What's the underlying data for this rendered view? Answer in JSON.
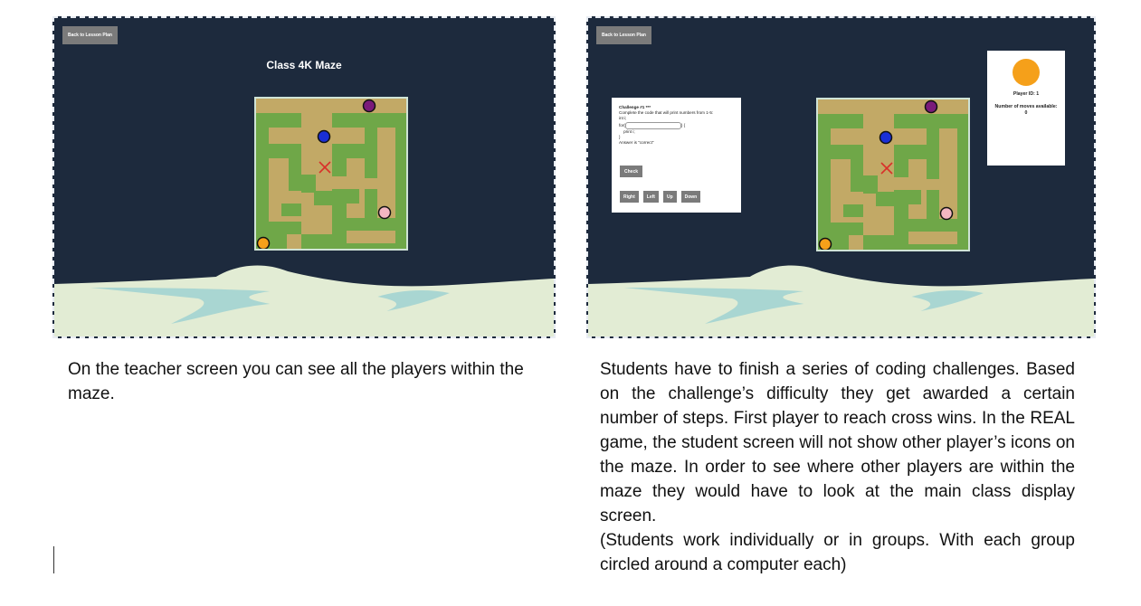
{
  "teacher_screen": {
    "back_button": "Back to Lesson Plan",
    "maze_title": "Class 4K Maze"
  },
  "student_screen": {
    "back_button": "Back to Lesson Plan",
    "challenge": {
      "title": "Challenge #1 ***",
      "instruction": "Complete the code that will print numbers from 1-5:",
      "code_line1": "int i;",
      "code_for": "for(",
      "code_for_end": ") {",
      "code_print": "    print i;",
      "code_close": "}",
      "answer_note": "Answer is \"correct\"",
      "check_button": "Check",
      "direction_buttons": [
        "Right",
        "Left",
        "Up",
        "Down"
      ]
    },
    "player": {
      "id_text": "Player ID: 1",
      "moves_text": "Number of moves available: 0",
      "color": "#f5a01a"
    }
  },
  "maze_pieces": {
    "players": [
      {
        "icon": "purple-player-icon",
        "color": "#7a1a7a"
      },
      {
        "icon": "blue-player-icon",
        "color": "#1a2fd6"
      },
      {
        "icon": "pink-player-icon",
        "color": "#f3b7c2"
      },
      {
        "icon": "orange-player-icon",
        "color": "#f5a01a"
      }
    ],
    "goal_icon": "red-cross-icon",
    "goal_color": "#d9302a"
  },
  "captions": {
    "teacher": "On the teacher screen you can see all the players within the maze.",
    "student_p1": "Students have to finish a series of coding challenges. Based on the challenge’s difficulty they get awarded a certain number of steps. First player to reach cross wins. In the REAL game, the student screen will not show other player’s icons on the maze. In order to see where other players are within the maze they would have to look at the main class display screen.",
    "student_p2": "(Students work individually or in groups. With each group circled around a computer each)"
  }
}
